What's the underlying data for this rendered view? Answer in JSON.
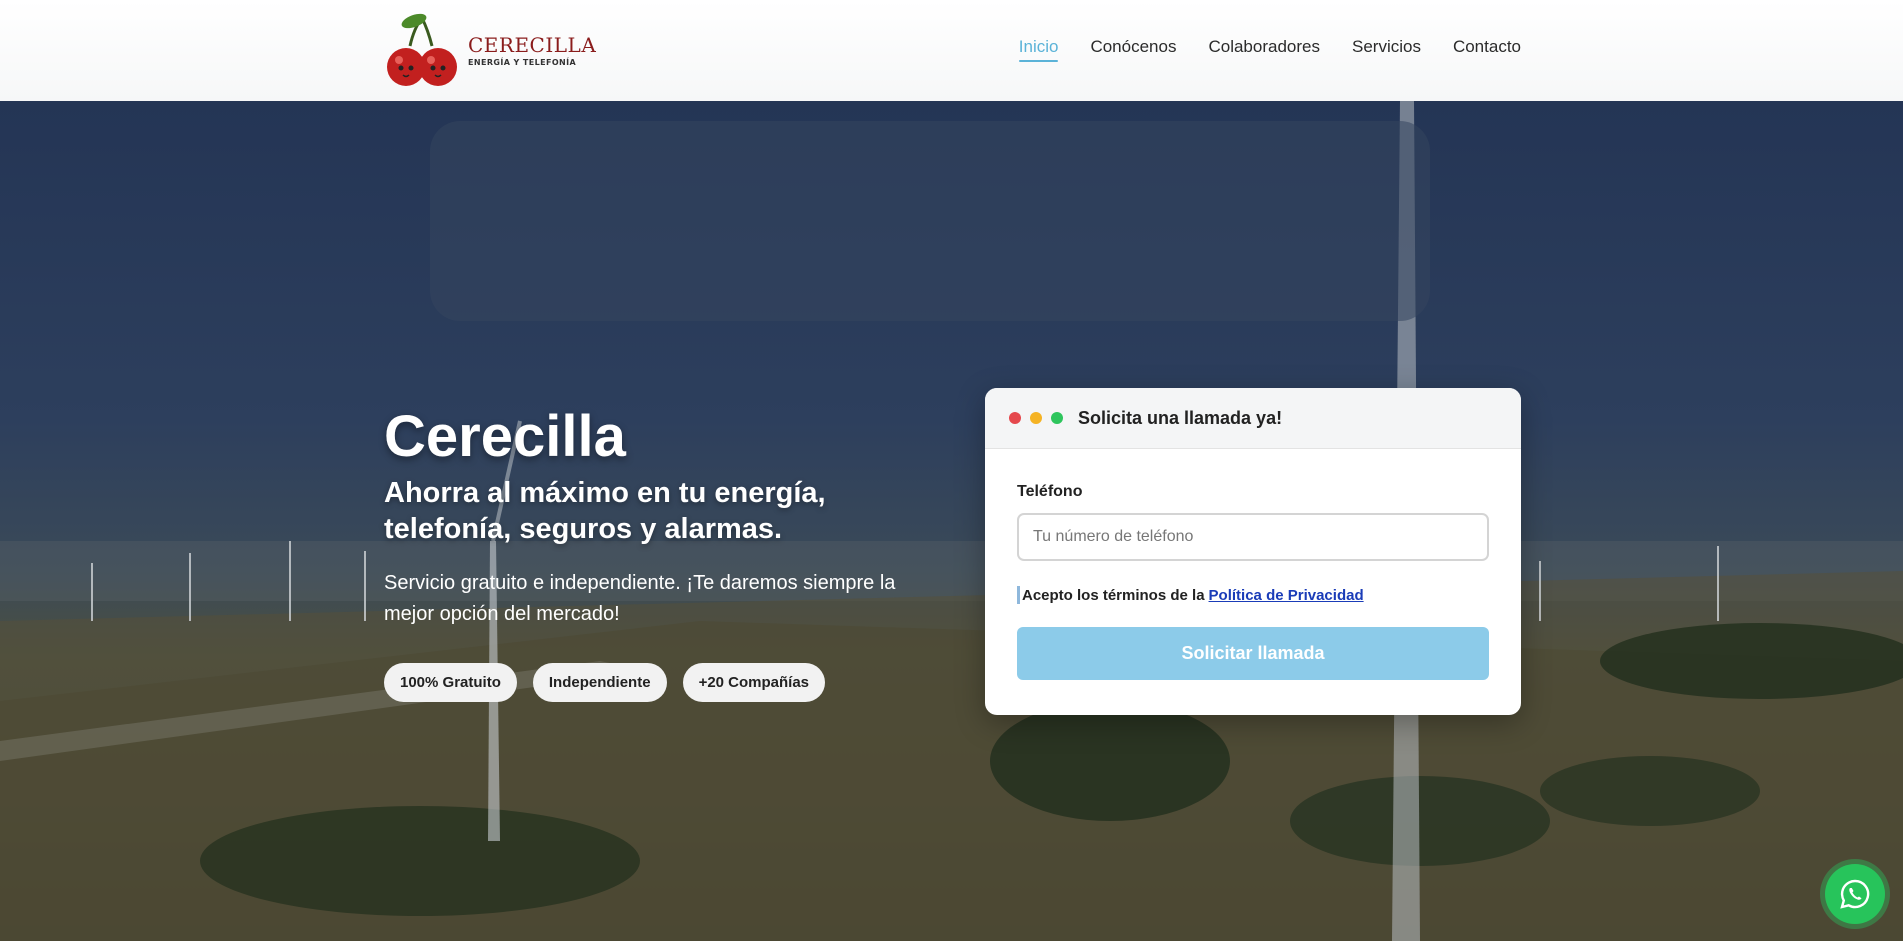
{
  "brand": {
    "name": "CERECILLA",
    "tagline": "ENERGÍA Y TELEFONÍA"
  },
  "nav": {
    "items": [
      {
        "label": "Inicio",
        "active": true
      },
      {
        "label": "Conócenos",
        "active": false
      },
      {
        "label": "Colaboradores",
        "active": false
      },
      {
        "label": "Servicios",
        "active": false
      },
      {
        "label": "Contacto",
        "active": false
      }
    ]
  },
  "hero": {
    "title": "Cerecilla",
    "subtitle": "Ahorra al máximo en tu energía, telefonía, seguros y alarmas.",
    "description": "Servicio gratuito e independiente. ¡Te daremos siempre la mejor opción del mercado!",
    "pills": [
      "100% Gratuito",
      "Independiente",
      "+20 Compañías"
    ]
  },
  "form": {
    "title": "Solicita una llamada ya!",
    "phone_label": "Teléfono",
    "phone_placeholder": "Tu número de teléfono",
    "phone_value": "",
    "terms_text": "Acepto los términos de la",
    "terms_link": "Política de Privacidad",
    "submit_label": "Solicitar llamada"
  },
  "icons": {
    "window_dots": [
      "red-dot-icon",
      "yellow-dot-icon",
      "green-dot-icon"
    ],
    "floating": "whatsapp-icon"
  },
  "colors": {
    "accent": "#5bb3d8",
    "submit": "#8ccbe9",
    "whatsapp": "#27c45b",
    "brand": "#8a1c1c",
    "dot_red": "#e5484d",
    "dot_yellow": "#f5b324",
    "dot_green": "#2ec55d"
  }
}
